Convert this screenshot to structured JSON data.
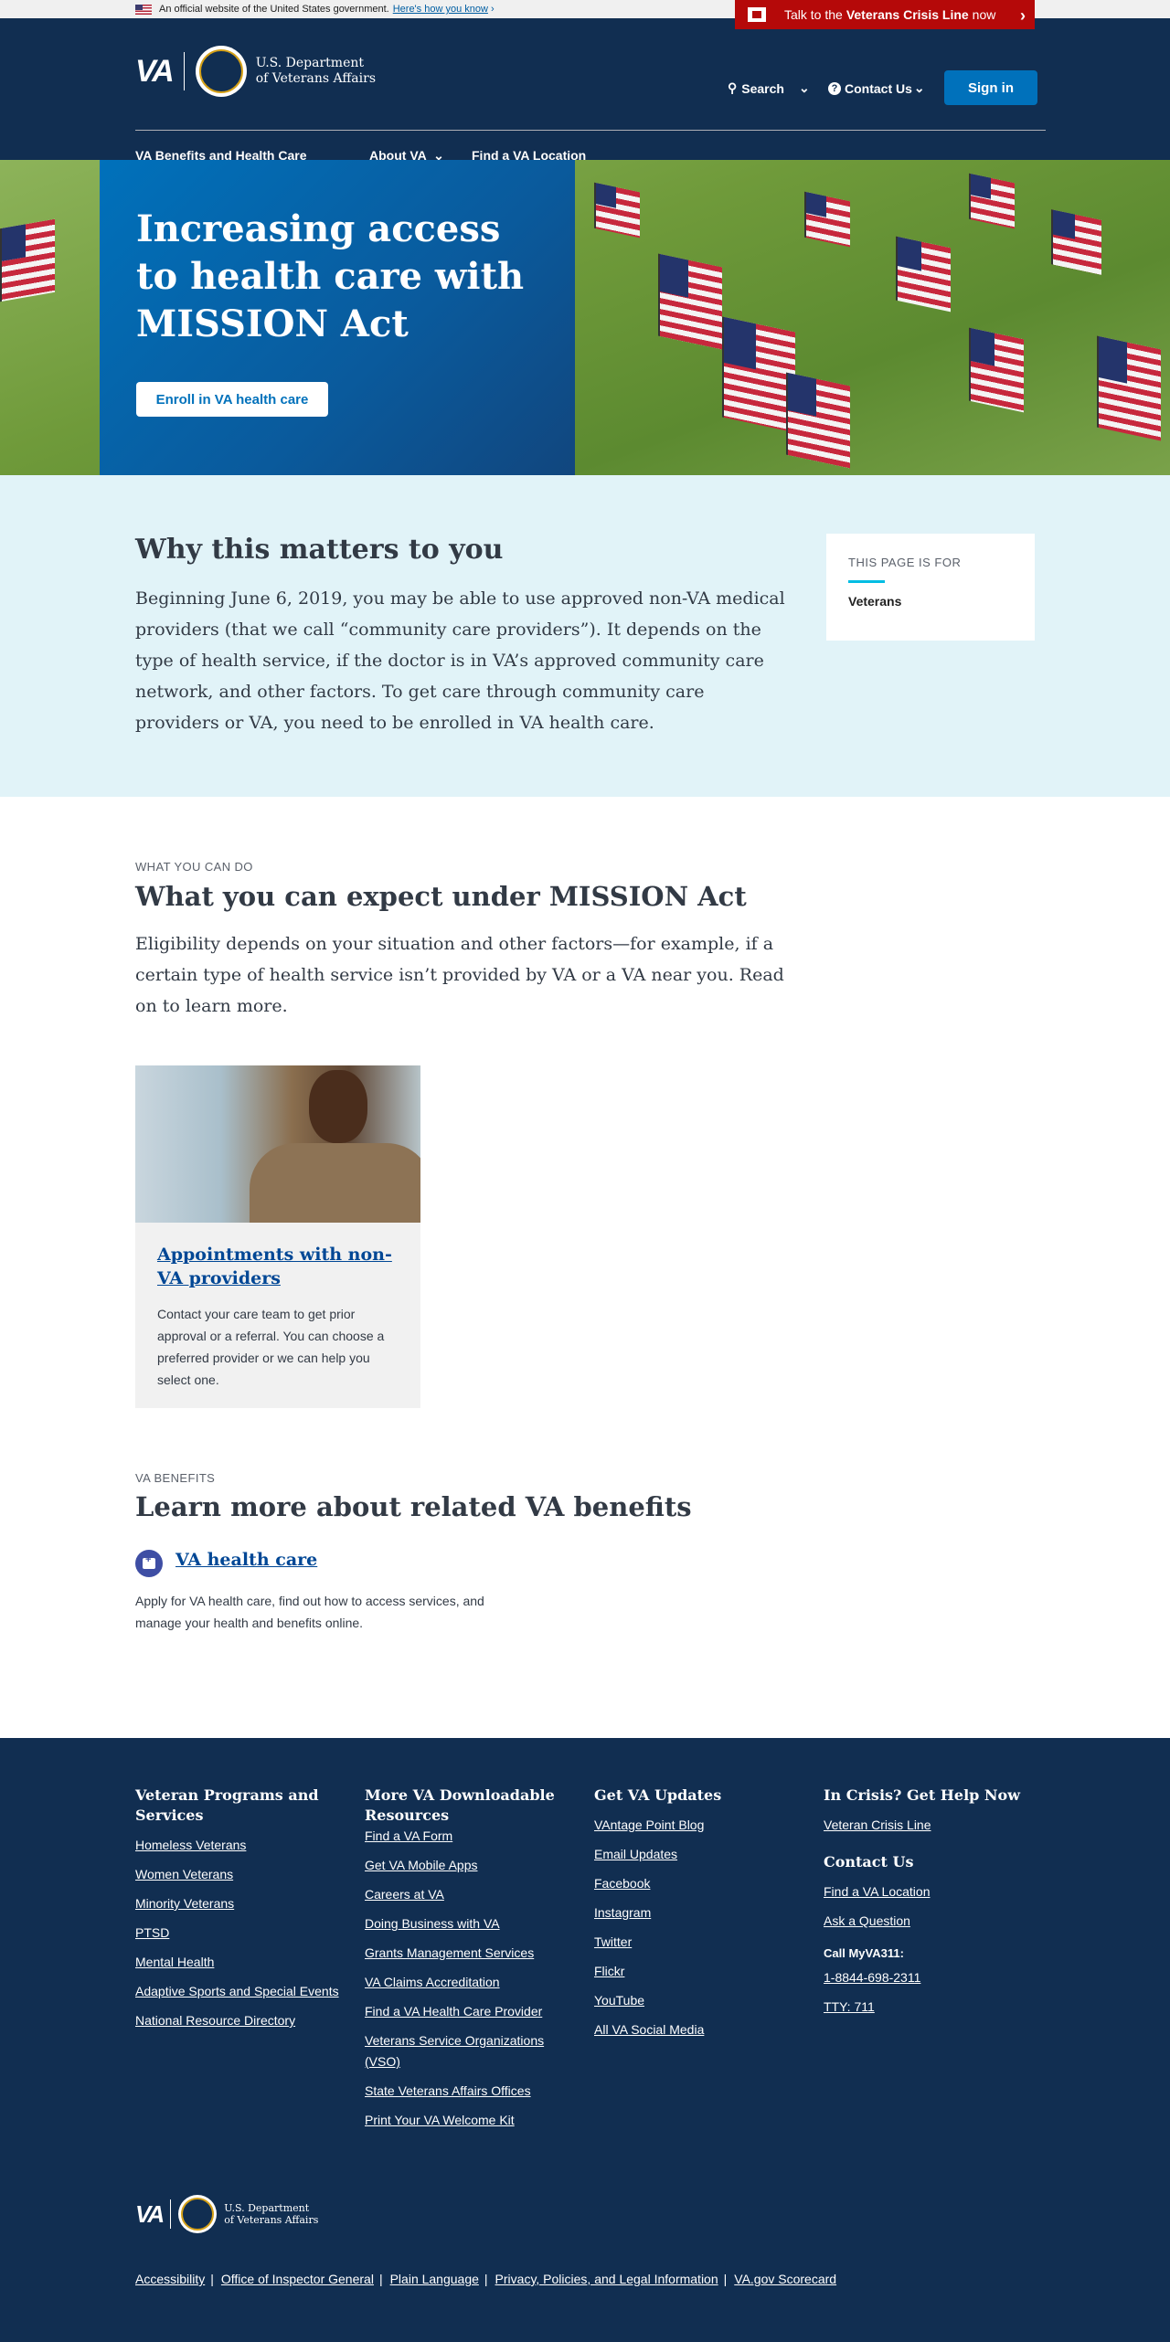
{
  "gov_banner": {
    "text": "An official website of the United States government.",
    "link": "Here's how you know"
  },
  "crisis": {
    "prefix": "Talk to the",
    "bold": "Veterans Crisis Line",
    "suffix": "now"
  },
  "header": {
    "logo_text": "VA",
    "dept_line1": "U.S. Department",
    "dept_line2": "of Veterans Affairs",
    "search": "Search",
    "contact": "Contact Us",
    "sign_in": "Sign in"
  },
  "main_nav": {
    "items": [
      {
        "label": "VA Benefits and Health Care"
      },
      {
        "label": "About VA"
      },
      {
        "label": "Find a VA Location"
      }
    ]
  },
  "hero": {
    "title": "Increasing access to health care with MISSION Act",
    "button": "Enroll in VA health care"
  },
  "why": {
    "title": "Why this matters to you",
    "body": "Beginning June 6, 2019, you may be able to use approved non-VA medical providers (that we call “community care providers”). It depends on the type of health service, if the doctor is in VA’s approved community care network, and other factors. To get care through community care providers or VA, you need to be enrolled in VA health care.",
    "page_for_label": "THIS PAGE IS FOR",
    "page_for_value": "Veterans"
  },
  "what": {
    "eyebrow": "WHAT YOU CAN DO",
    "title": "What you can expect under MISSION Act",
    "body": "Eligibility depends on your situation and other factors—for example, if a certain type of health service isn’t provided by VA or a VA near you. Read on to learn more.",
    "card": {
      "link": "Appointments with non-VA providers",
      "text": "Contact your care team to get prior approval or a referral. You can choose a preferred provider or we can help you select one."
    }
  },
  "benefits": {
    "eyebrow": "VA BENEFITS",
    "title": "Learn more about related VA benefits",
    "link": "VA health care",
    "text": "Apply for VA health care, find out how to access services, and manage your health and benefits online."
  },
  "footer": {
    "col1": {
      "title": "Veteran Programs and Services",
      "links": [
        "Homeless Veterans",
        "Women Veterans",
        "Minority Veterans",
        "PTSD",
        "Mental Health",
        "Adaptive Sports and Special Events",
        "National Resource Directory"
      ]
    },
    "col2": {
      "title": "More VA Downloadable Resources",
      "links": [
        "Find a VA Form",
        "Get VA Mobile Apps",
        "Careers at VA",
        "Doing Business with VA",
        "Grants Management Services",
        "VA Claims Accreditation",
        "Find a VA Health Care Provider",
        "Veterans Service Organizations (VSO)",
        "State Veterans Affairs Offices",
        "Print Your VA Welcome Kit"
      ]
    },
    "col3": {
      "title": "Get VA Updates",
      "links": [
        "VAntage Point Blog",
        "Email Updates",
        "Facebook",
        "Instagram",
        "Twitter",
        "Flickr",
        "YouTube",
        "All VA Social Media"
      ]
    },
    "col4": {
      "title": "In Crisis? Get Help Now",
      "crisis_link": "Veteran Crisis Line",
      "contact_title": "Contact Us",
      "contact_links": [
        "Find a VA Location",
        "Ask a Question"
      ],
      "call_label": "Call MyVA311:",
      "phone": "1-8844-698-2311",
      "tty": "TTY: 711"
    },
    "logo_text": "VA",
    "dept_line1": "U.S. Department",
    "dept_line2": "of Veterans Affairs",
    "bottom_links": [
      "Accessibility",
      "Office of Inspector General",
      "Plain Language",
      "Privacy, Policies, and Legal Information",
      "VA.gov Scorecard"
    ]
  }
}
